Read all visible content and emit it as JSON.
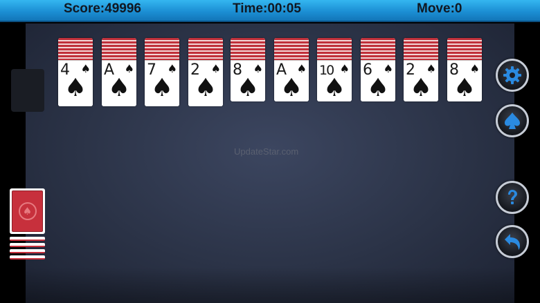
{
  "status_bar": {
    "score": "Score:49996",
    "time": "Time:00:05",
    "move": "Move:0"
  },
  "watermark": "UpdateStar.com",
  "tableau": [
    {
      "rank": "4",
      "suit": "♠"
    },
    {
      "rank": "A",
      "suit": "♠"
    },
    {
      "rank": "7",
      "suit": "♠"
    },
    {
      "rank": "2",
      "suit": "♠"
    },
    {
      "rank": "8",
      "suit": "♠"
    },
    {
      "rank": "A",
      "suit": "♠"
    },
    {
      "rank": "10",
      "suit": "♠"
    },
    {
      "rank": "6",
      "suit": "♠"
    },
    {
      "rank": "2",
      "suit": "♠"
    },
    {
      "rank": "8",
      "suit": "♠"
    }
  ],
  "stock": {
    "deal_piles_remaining": 5
  },
  "buttons": [
    {
      "name": "settings-button",
      "icon": "gear-icon"
    },
    {
      "name": "suit-mode-button",
      "icon": "spade-icon"
    },
    {
      "name": "hint-button",
      "icon": "question-icon"
    },
    {
      "name": "undo-button",
      "icon": "undo-arrow-icon"
    }
  ],
  "colors": {
    "top_bar": "#1c8fd4",
    "table_felt": "#2b3347",
    "card_back": "#c0303a",
    "icon_blue": "#2a8ae0"
  }
}
